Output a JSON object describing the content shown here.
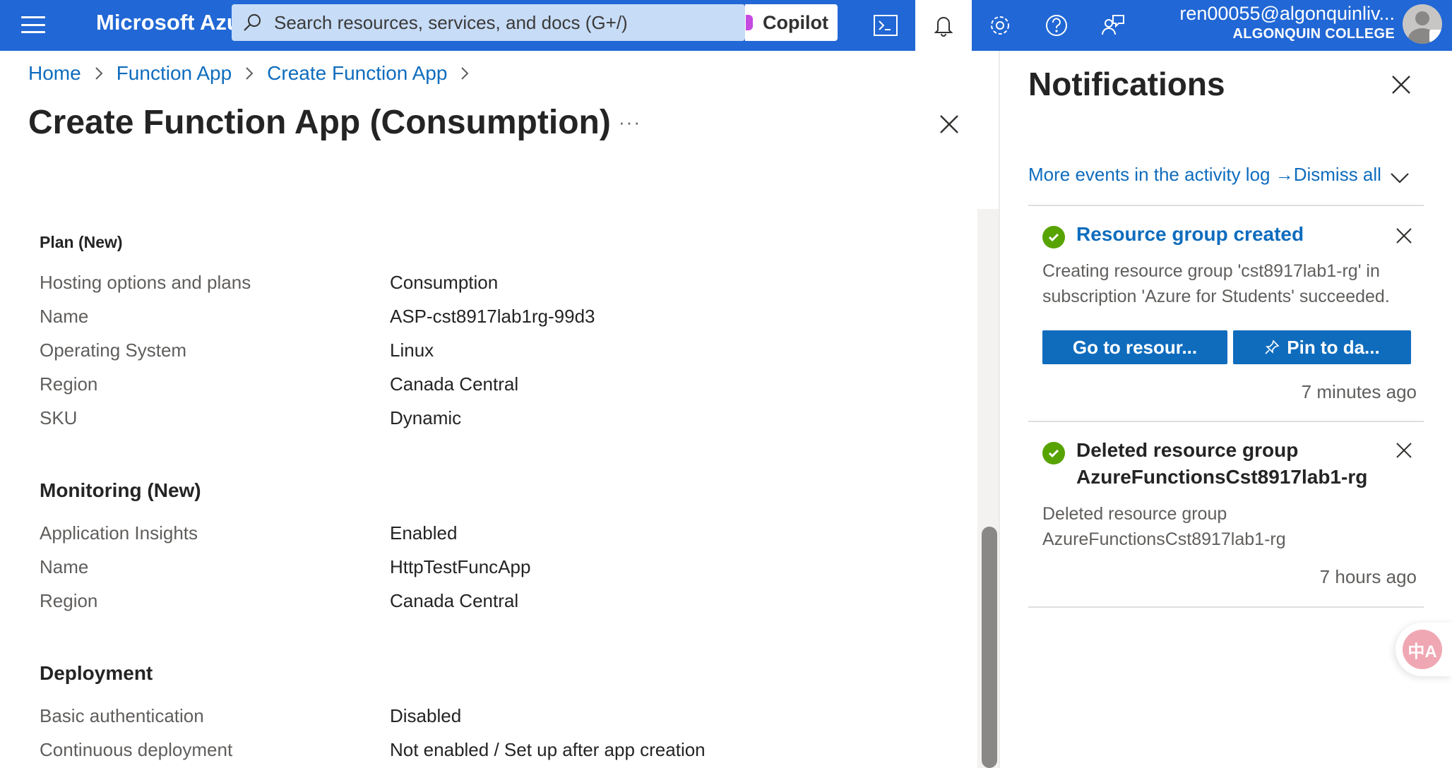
{
  "topbar": {
    "brand": "Microsoft Azure",
    "search_placeholder": "Search resources, services, and docs (G+/)",
    "copilot_label": "Copilot",
    "user_name": "ren00055@algonquinliv...",
    "user_org": "ALGONQUIN COLLEGE",
    "icons": [
      "menu-icon",
      "search-icon",
      "cloud-shell-icon",
      "bell-icon",
      "gear-icon",
      "help-icon",
      "feedback-icon"
    ],
    "accent": "#2167d5"
  },
  "breadcrumb": [
    "Home",
    "Function App",
    "Create Function App"
  ],
  "page_title": "Create Function App (Consumption)",
  "more_label": "···",
  "sections": {
    "plan": {
      "heading": "Plan (New)",
      "rows": [
        {
          "label": "Hosting options and plans",
          "value": "Consumption"
        },
        {
          "label": "Name",
          "value": "ASP-cst8917lab1rg-99d3"
        },
        {
          "label": "Operating System",
          "value": "Linux"
        },
        {
          "label": "Region",
          "value": "Canada Central"
        },
        {
          "label": "SKU",
          "value": "Dynamic"
        }
      ]
    },
    "monitoring": {
      "heading": "Monitoring (New)",
      "rows": [
        {
          "label": "Application Insights",
          "value": "Enabled"
        },
        {
          "label": "Name",
          "value": "HttpTestFuncApp"
        },
        {
          "label": "Region",
          "value": "Canada Central"
        }
      ]
    },
    "deployment": {
      "heading": "Deployment",
      "rows": [
        {
          "label": "Basic authentication",
          "value": "Disabled"
        },
        {
          "label": "Continuous deployment",
          "value": "Not enabled / Set up after app creation"
        }
      ]
    }
  },
  "notifications": {
    "title": "Notifications",
    "activity_link": "More events in the activity log →",
    "dismiss_all": "Dismiss all",
    "items": [
      {
        "title": "Resource group created",
        "body": "Creating resource group 'cst8917lab1-rg' in subscription 'Azure for Students' succeeded.",
        "buttons": [
          "Go to resour...",
          "Pin to da..."
        ],
        "time": "7 minutes ago",
        "status_color": "#57a300"
      },
      {
        "title_line1": "Deleted resource group",
        "title_line2": "AzureFunctionsCst8917lab1-rg",
        "body_line1": "Deleted resource group",
        "body_line2": "AzureFunctionsCst8917lab1-rg",
        "time": "7 hours ago",
        "status_color": "#57a300"
      }
    ]
  },
  "translate_label": "中A"
}
